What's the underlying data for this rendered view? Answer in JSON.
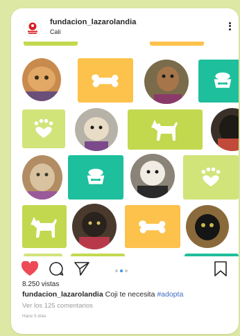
{
  "post": {
    "username": "fundacion_lazarolandia",
    "location": "Cali",
    "avatar_label": "fundación lazarolandia",
    "views": "8.250 vistas",
    "caption_username": "fundacion_lazarolandia",
    "caption_text": " Coji te necesita ",
    "caption_hashtag": "#adopta",
    "comments_link": "Ver los 125 comentarios",
    "time": "Hace 5 días",
    "liked": true,
    "carousel_active_index": 1,
    "carousel_total": 3
  },
  "icons": {
    "more": "more-vertical-icon",
    "like": "heart-filled-icon",
    "comment": "comment-icon",
    "share": "send-icon",
    "save": "bookmark-icon",
    "bone": "bone-icon",
    "food_bowl": "pet-bowl-icon",
    "paws_heart": "paw-heart-icon",
    "dog_silhouette": "dog-icon"
  },
  "colors": {
    "like": "#ed4956",
    "link": "#3d6dc1",
    "carousel_active": "#3897f0",
    "tile_yellow": "#fcc24c",
    "tile_green": "#c2d94f",
    "tile_teal": "#1ebf9c"
  }
}
